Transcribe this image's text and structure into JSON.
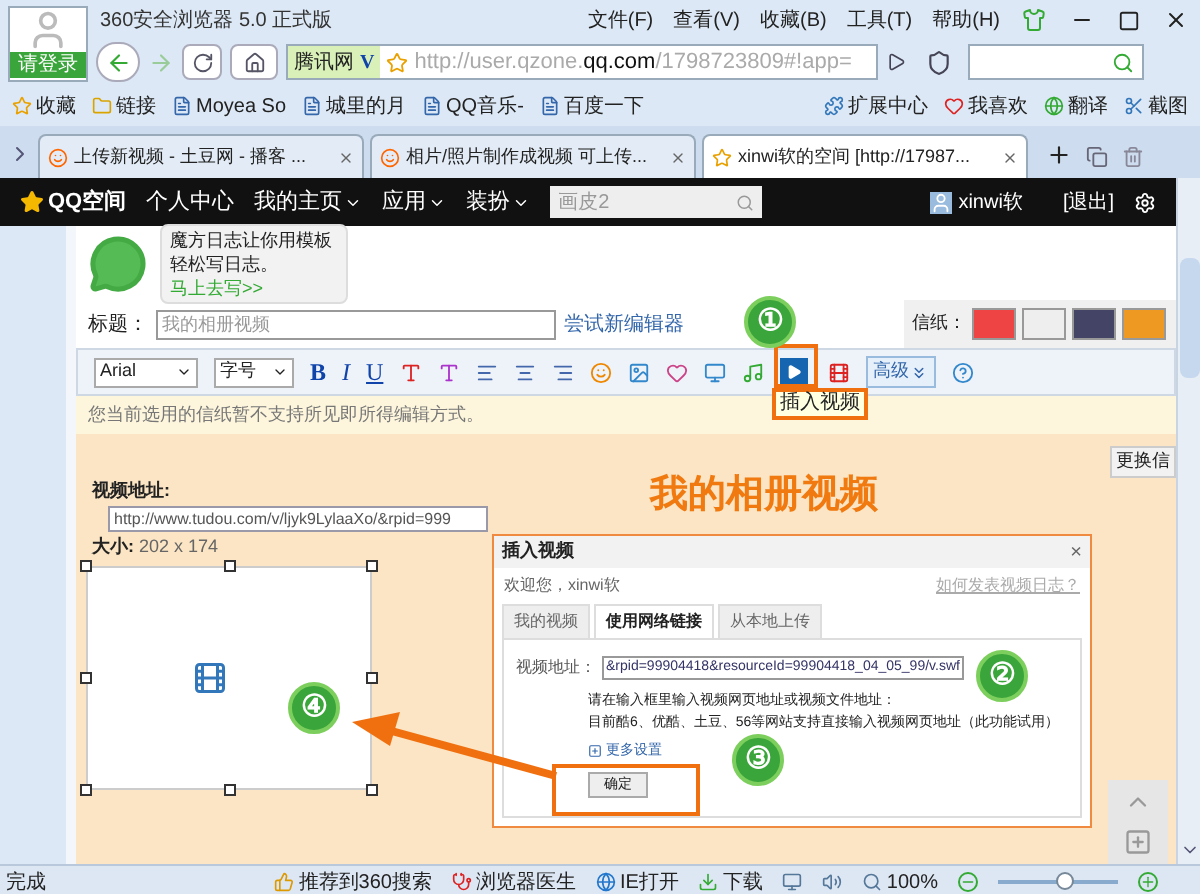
{
  "window": {
    "title": "360安全浏览器 5.0 正式版",
    "login": "请登录"
  },
  "menu": [
    "文件(F)",
    "查看(V)",
    "收藏(B)",
    "工具(T)",
    "帮助(H)"
  ],
  "address_bar": {
    "engine": "腾讯网",
    "engine_badge": "V",
    "url_prefix": "http://user.qzone.",
    "url_domain": "qq.com",
    "url_path": "/1798723809#!app="
  },
  "bookmarks": [
    "收藏",
    "链接",
    "Moyea So",
    "城里的月",
    "QQ音乐-",
    "百度一下"
  ],
  "bookmarks_right": [
    "扩展中心",
    "我喜欢",
    "翻译",
    "截图"
  ],
  "tabs": [
    {
      "label": "上传新视频 - 土豆网 - 播客 ...",
      "selected": false
    },
    {
      "label": "相片/照片制作成视频 可上传...",
      "selected": false
    },
    {
      "label": "xinwi软的空间 [http://17987...",
      "selected": true
    }
  ],
  "qzone_nav": {
    "logo": "QQ空间",
    "items": [
      {
        "label": "个人中心",
        "dropdown": false
      },
      {
        "label": "我的主页",
        "dropdown": true
      },
      {
        "label": "应用",
        "dropdown": true
      },
      {
        "label": "装扮",
        "dropdown": true
      }
    ],
    "search_placeholder": "画皮2",
    "user": "xinwi软",
    "logout": "[退出]"
  },
  "promo": {
    "text": "魔方日志让你用模板轻松写日志。",
    "link": "马上去写>>"
  },
  "title_field": {
    "label": "标题：",
    "value": "我的相册视频"
  },
  "new_editor_link": "尝试新编辑器",
  "stationery_label": "信纸：",
  "toolbar": {
    "font": "Arial",
    "size": "字号",
    "format": [
      "B",
      "I",
      "U"
    ],
    "advanced": "高级",
    "tooltip": "插入视频"
  },
  "notice": "您当前选用的信纸暂不支持所见即所得编辑方式。",
  "letter": {
    "heading": "我的相册视频",
    "change_button": "更换信",
    "video_label": "视频地址:",
    "video_url": "http://www.tudou.com/v/ljyk9LylaaXo/&rpid=999",
    "size_label": "大小:",
    "size_value": "202 x 174"
  },
  "dialog": {
    "title": "插入视频",
    "close": "×",
    "welcome": "欢迎您，xinwi软",
    "help_link": "如何发表视频日志？",
    "tabs": [
      {
        "label": "我的视频",
        "selected": false
      },
      {
        "label": "使用网络链接",
        "selected": true
      },
      {
        "label": "从本地上传",
        "selected": false
      }
    ],
    "url_label": "视频地址：",
    "url_value": "&rpid=99904418&resourceId=99904418_04_05_99/v.swf",
    "hint_lines": [
      "请在输入框里输入视频网页地址或视频文件地址：",
      "目前酷6、优酷、土豆、56等网站支持直接输入视频网页地址（此功能试用）"
    ],
    "more_settings": "更多设置",
    "ok": "确定"
  },
  "callouts": [
    "①",
    "②",
    "③",
    "④"
  ],
  "status_bar": {
    "status": "完成",
    "items": [
      "推荐到360搜索",
      "浏览器医生",
      "IE打开",
      "下载"
    ],
    "zoom": "100%",
    "zoom_slider": {
      "level": 0.55
    }
  }
}
